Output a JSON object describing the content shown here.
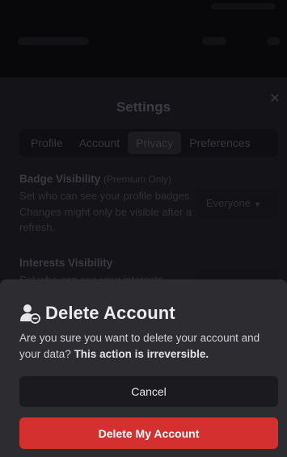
{
  "background": {
    "settings": {
      "title": "Settings",
      "close_icon": "close-icon",
      "tabs": [
        {
          "label": "Profile",
          "active": false
        },
        {
          "label": "Account",
          "active": false
        },
        {
          "label": "Privacy",
          "active": true
        },
        {
          "label": "Preferences",
          "active": false
        }
      ],
      "badge_visibility": {
        "heading": "Badge Visibility",
        "note": "(Premium Only)",
        "description": "Set who can see your profile badges. Changes might only be visible after a refresh.",
        "select_value": "Everyone"
      },
      "interests_visibility": {
        "heading": "Interests Visibility",
        "description": "Set who can see your interests"
      }
    }
  },
  "dialog": {
    "icon": "user-minus-icon",
    "title": "Delete Account",
    "message": "Are you sure you want to delete your account and your data?",
    "message_emphasis": "This action is irreversible.",
    "cancel_label": "Cancel",
    "delete_label": "Delete My Account"
  },
  "colors": {
    "danger": "#d3302f",
    "sheet_bg": "#2c2c31",
    "cancel_bg": "#1b1a1f"
  }
}
